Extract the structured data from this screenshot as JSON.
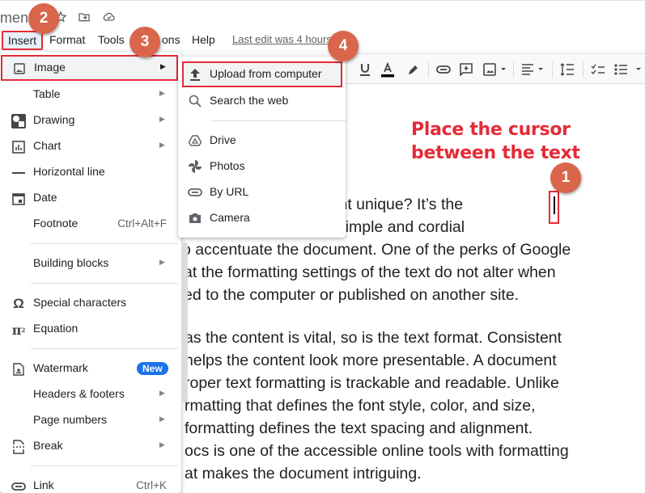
{
  "title_bar": {
    "doc_title_fragment": "men",
    "icons": [
      "star-icon",
      "move-to-folder-icon",
      "cloud-saved-icon"
    ]
  },
  "menubar": {
    "items": [
      {
        "label": "Insert",
        "active": true
      },
      {
        "label": "Format"
      },
      {
        "label": "Tools"
      },
      {
        "label": "ons"
      },
      {
        "label": "Help"
      }
    ],
    "last_edit": "Last edit was 4 hours ago"
  },
  "toolbar": {
    "icons": [
      "underline-icon",
      "text-color-icon",
      "highlight-icon",
      "link-icon",
      "comment-icon",
      "image-icon",
      "align-icon",
      "line-spacing-icon",
      "checklist-icon",
      "bullet-list-icon"
    ],
    "text_color": "#000000"
  },
  "insert_menu": {
    "items": [
      {
        "label": "Image",
        "icon": "image-icon",
        "submenu": true,
        "highlighted": true
      },
      {
        "label": "Table",
        "submenu": true
      },
      {
        "label": "Drawing",
        "icon": "drawing-icon",
        "submenu": true
      },
      {
        "label": "Chart",
        "icon": "chart-icon",
        "submenu": true
      },
      {
        "label": "Horizontal line",
        "icon": "horizontal-line-icon"
      },
      {
        "label": "Date",
        "icon": "calendar-icon"
      },
      {
        "label": "Footnote",
        "shortcut": "Ctrl+Alt+F"
      },
      {
        "label": "Building blocks",
        "submenu": true
      },
      {
        "label": "Special characters",
        "icon": "omega-icon"
      },
      {
        "label": "Equation",
        "icon": "pi-icon"
      },
      {
        "label": "Watermark",
        "icon": "watermark-icon",
        "badge": "New"
      },
      {
        "label": "Headers & footers",
        "submenu": true
      },
      {
        "label": "Page numbers",
        "submenu": true
      },
      {
        "label": "Break",
        "icon": "break-icon",
        "submenu": true
      },
      {
        "label": "Link",
        "icon": "link-icon",
        "shortcut": "Ctrl+K"
      }
    ]
  },
  "image_submenu": {
    "items": [
      {
        "label": "Upload from computer",
        "icon": "upload-icon",
        "highlighted": true
      },
      {
        "label": "Search the web",
        "icon": "search-icon"
      },
      {
        "label": "Drive",
        "icon": "drive-icon"
      },
      {
        "label": "Photos",
        "icon": "photos-icon"
      },
      {
        "label": "By URL",
        "icon": "link-icon"
      },
      {
        "label": "Camera",
        "icon": "camera-icon"
      }
    ]
  },
  "document": {
    "paragraph1": [
      "makes a document unique? It’s the",
      "e Docs offers simple and cordial",
      "o accentuate the document. One of the perks of Google",
      "at the formatting settings of the text do not alter when",
      "ed to the computer or published on another site."
    ],
    "paragraph2": [
      "as the content is vital, so is the text format. Consistent",
      " helps the content look more presentable. A document",
      "roper text formatting is trackable and readable. Unlike",
      "rmatting that defines the font style, color, and size,",
      " formatting defines the text spacing and alignment.",
      "ocs is one of the accessible online tools with formatting",
      "at makes the document intriguing."
    ]
  },
  "annotations": {
    "instruction": [
      "Place the cursor",
      "between the text"
    ],
    "steps": [
      "1",
      "2",
      "3",
      "4"
    ],
    "highlight_color": "#e52b36",
    "bubble_color": "#d9654a"
  }
}
